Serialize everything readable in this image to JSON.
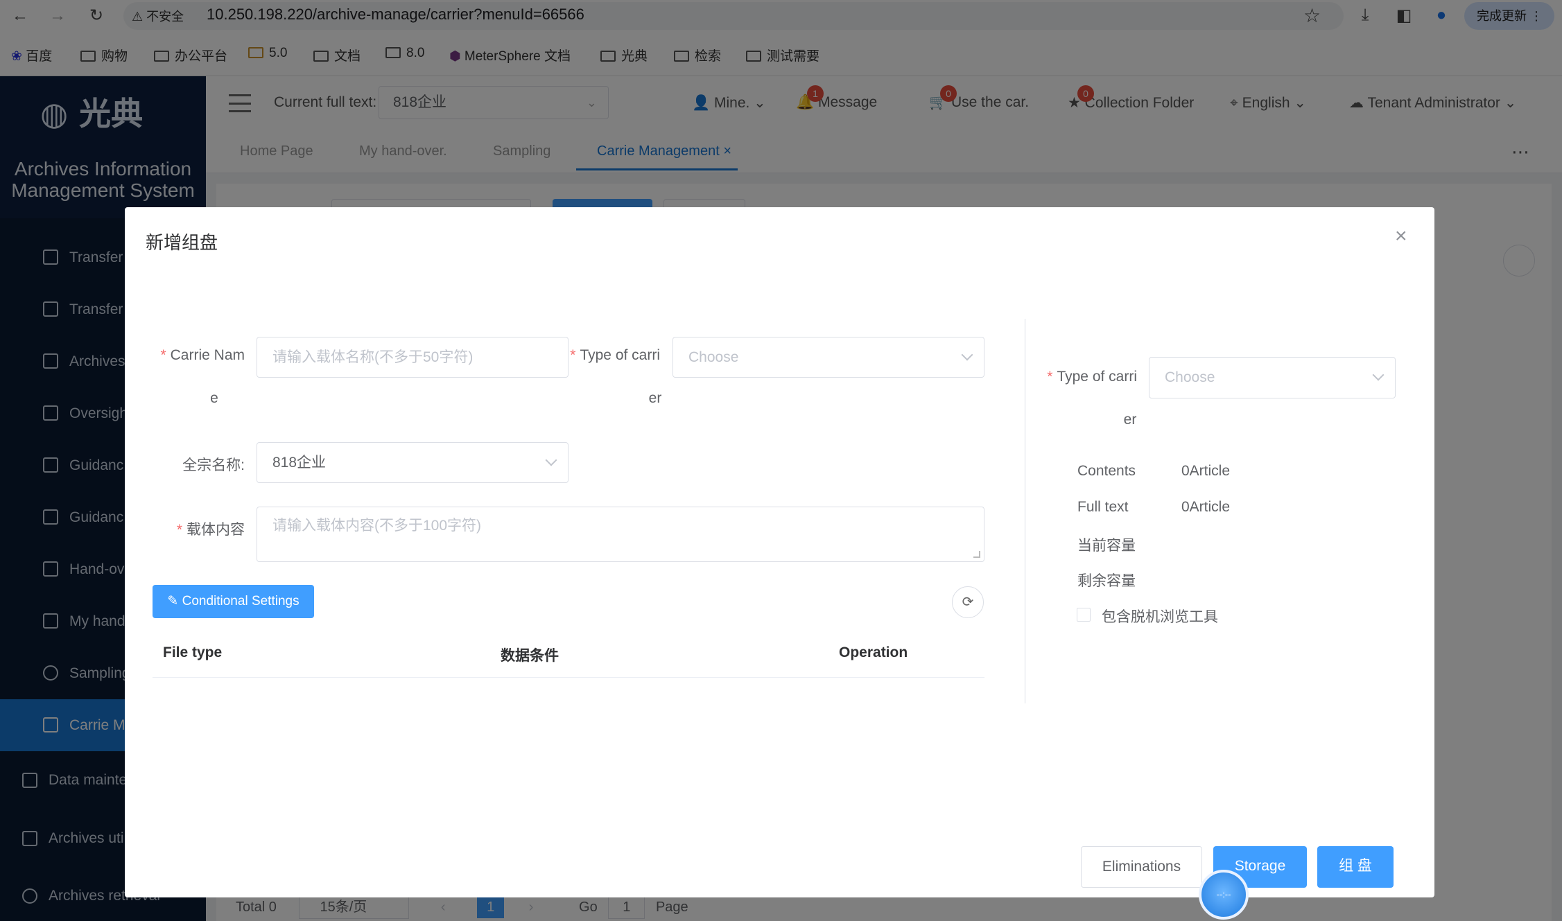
{
  "browser": {
    "insecure_label": "不安全",
    "url": "10.250.198.220/archive-manage/carrier?menuId=66566",
    "update_button": "完成更新",
    "bookmarks": [
      "百度",
      "购物",
      "办公平台",
      "5.0",
      "文档",
      "8.0",
      "MeterSphere 文档",
      "光典",
      "检索",
      "测试需要"
    ]
  },
  "app": {
    "logo_text": "光典",
    "system_title_line1": "Archives Information",
    "system_title_line2": "Management System",
    "sidebar": {
      "items": [
        "Transfer",
        "Transfer",
        "Archives",
        "Oversigh",
        "Guidanc",
        "Guidanc",
        "Hand-ov",
        "My hand",
        "Sampling",
        "Carrie M"
      ],
      "groups": [
        "Data mainte",
        "Archives uti",
        "Archives retrieval"
      ]
    },
    "header": {
      "fulltext_label": "Current full text:",
      "fulltext_value": "818企业",
      "mine": "Mine.",
      "message": "Message",
      "message_badge": "1",
      "cart": "Use the car.",
      "cart_badge": "0",
      "collection": "Collection Folder",
      "collection_badge": "0",
      "language": "English",
      "tenant": "Tenant Administrator"
    },
    "tabs": [
      "Home Page",
      "My hand-over.",
      "Sampling",
      "Carrie Management"
    ],
    "tab_close": "×",
    "pager": {
      "total": "Total 0",
      "page_size": "15条/页",
      "current": "1",
      "go": "Go",
      "go_value": "1",
      "page": "Page"
    }
  },
  "dialog": {
    "title": "新增组盘",
    "close": "×",
    "carrier_name_label_1": "Carrie Nam",
    "carrier_name_label_2": "e",
    "carrier_name_placeholder": "请输入载体名称(不多于50字符)",
    "type_label_1": "Type of carri",
    "type_label_2": "er",
    "type_placeholder": "Choose",
    "fonds_label": "全宗名称:",
    "fonds_value": "818企业",
    "content_label": "载体内容",
    "content_placeholder": "请输入载体内容(不多于100字符)",
    "conditional_settings": "Conditional Settings",
    "table_headers": [
      "File type",
      "数据条件",
      "Operation"
    ],
    "right": {
      "type_label_1": "Type of carri",
      "type_label_2": "er",
      "type_placeholder": "Choose",
      "contents_label": "Contents",
      "contents_value": "0Article",
      "fulltext_label": "Full text",
      "fulltext_value": "0Article",
      "current_capacity": "当前容量",
      "remaining_capacity": "剩余容量",
      "offline_tool": "包含脱机浏览工具"
    },
    "buttons": {
      "eliminations": "Eliminations",
      "storage": "Storage",
      "group": "组 盘"
    },
    "float_ball": "--:--"
  }
}
